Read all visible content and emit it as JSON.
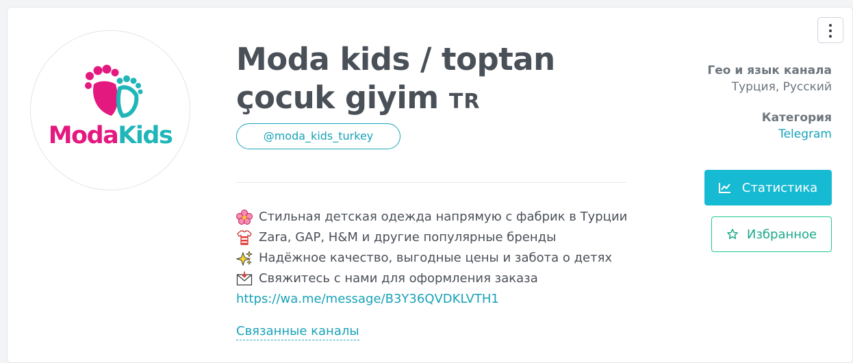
{
  "channel": {
    "title_line1": "Moda kids / toptan",
    "title_line2": "çocuk giyim",
    "title_flag": "TR",
    "handle": "@moda_kids_turkey"
  },
  "logo": {
    "word1": "Moda",
    "word2": "Kids",
    "pink": "#e4197f",
    "teal": "#20b6b9"
  },
  "description": {
    "lines": [
      {
        "icon": "flower-icon",
        "text": "Стильная детская одежда напрямую с фабрик в Турции"
      },
      {
        "icon": "shirt-icon",
        "text": "Zara, GAP, H&M и другие популярные бренды"
      },
      {
        "icon": "sparkles-icon",
        "text": "Надёжное качество, выгодные цены и забота о детях"
      },
      {
        "icon": "envelope-icon",
        "text": "Свяжитесь с нами для оформления заказа"
      }
    ],
    "link": "https://wa.me/message/B3Y36QVDKLVTH1"
  },
  "related_channels_label": "Связанные каналы",
  "meta": {
    "geo_label": "Гео и язык канала",
    "geo_value": "Турция, Русский",
    "category_label": "Категория",
    "category_value": "Telegram"
  },
  "buttons": {
    "stats_label": "Статистика",
    "favorite_label": "Избранное"
  },
  "colors": {
    "accent": "#17a2b8",
    "stats_button": "#17bad3",
    "favorite_border": "#20c997"
  }
}
